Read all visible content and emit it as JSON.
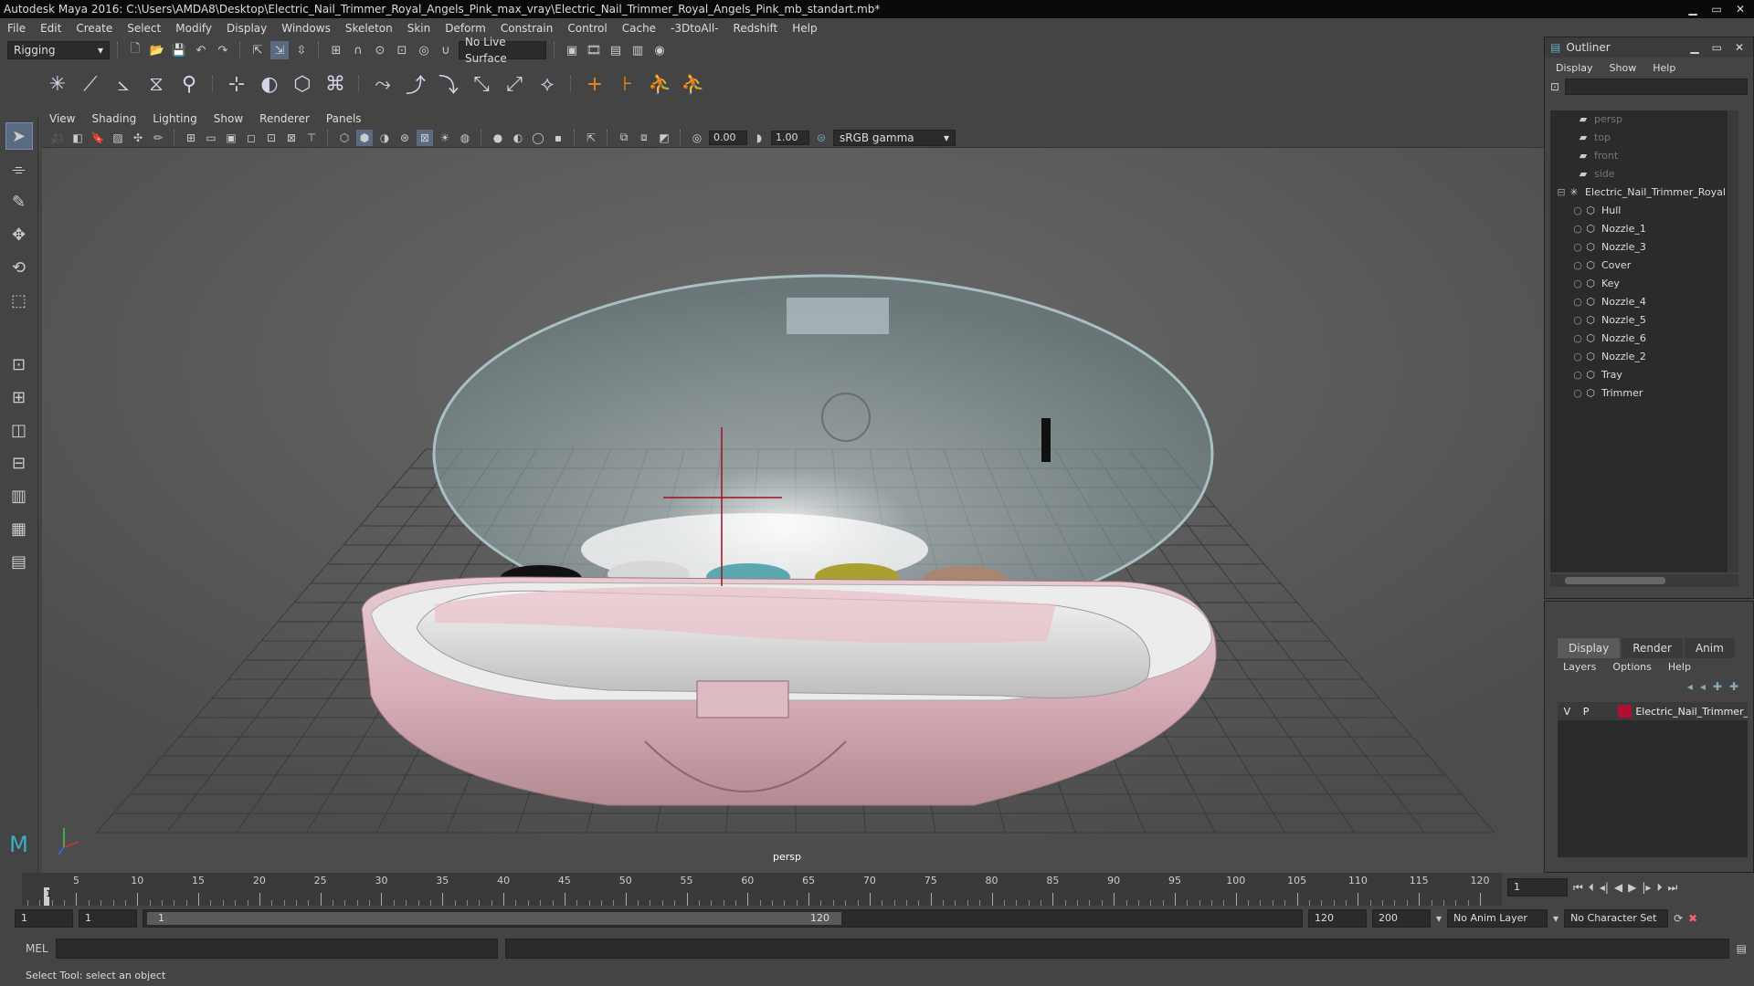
{
  "window": {
    "title": "Autodesk Maya 2016: C:\\Users\\AMDA8\\Desktop\\Electric_Nail_Trimmer_Royal_Angels_Pink_max_vray\\Electric_Nail_Trimmer_Royal_Angels_Pink_mb_standart.mb*"
  },
  "menu": [
    "File",
    "Edit",
    "Create",
    "Select",
    "Modify",
    "Display",
    "Windows",
    "Skeleton",
    "Skin",
    "Deform",
    "Constrain",
    "Control",
    "Cache",
    "-3DtoAll-",
    "Redshift",
    "Help"
  ],
  "shelf": {
    "mode": "Rigging",
    "live_surface": "No Live Surface"
  },
  "viewport": {
    "menu": [
      "View",
      "Shading",
      "Lighting",
      "Show",
      "Renderer",
      "Panels"
    ],
    "exposure": "0.00",
    "gamma": "1.00",
    "color_space": "sRGB gamma",
    "camera_label": "persp"
  },
  "outliner": {
    "title": "Outliner",
    "menu": [
      "Display",
      "Show",
      "Help"
    ],
    "items": [
      {
        "label": "persp",
        "type": "camera",
        "dim": true
      },
      {
        "label": "top",
        "type": "camera",
        "dim": true
      },
      {
        "label": "front",
        "type": "camera",
        "dim": true
      },
      {
        "label": "side",
        "type": "camera",
        "dim": true
      },
      {
        "label": "Electric_Nail_Trimmer_Royal",
        "type": "group"
      },
      {
        "label": "Hull",
        "type": "mesh"
      },
      {
        "label": "Nozzle_1",
        "type": "mesh"
      },
      {
        "label": "Nozzle_3",
        "type": "mesh"
      },
      {
        "label": "Cover",
        "type": "mesh"
      },
      {
        "label": "Key",
        "type": "mesh"
      },
      {
        "label": "Nozzle_4",
        "type": "mesh"
      },
      {
        "label": "Nozzle_5",
        "type": "mesh"
      },
      {
        "label": "Nozzle_6",
        "type": "mesh"
      },
      {
        "label": "Nozzle_2",
        "type": "mesh"
      },
      {
        "label": "Tray",
        "type": "mesh"
      },
      {
        "label": "Trimmer",
        "type": "mesh"
      }
    ]
  },
  "layers": {
    "tabs": [
      "Display",
      "Render",
      "Anim"
    ],
    "menu": [
      "Layers",
      "Options",
      "Help"
    ],
    "row": {
      "v": "V",
      "p": "P",
      "name": "Electric_Nail_Trimmer_F",
      "color": "#b01030"
    }
  },
  "timeline": {
    "ticks": [
      "5",
      "10",
      "15",
      "20",
      "25",
      "30",
      "35",
      "40",
      "45",
      "50",
      "55",
      "60",
      "65",
      "70",
      "75",
      "80",
      "85",
      "90",
      "95",
      "100",
      "105",
      "110",
      "115",
      "120"
    ],
    "current_frame": "1",
    "current_field": "1"
  },
  "range": {
    "start": "1",
    "playback_start": "1",
    "slider_start": "1",
    "slider_end": "120",
    "playback_end": "120",
    "end": "200",
    "anim_layer": "No Anim Layer",
    "char_set": "No Character Set"
  },
  "cmd": {
    "label": "MEL"
  },
  "help_line": "Select Tool: select an object"
}
